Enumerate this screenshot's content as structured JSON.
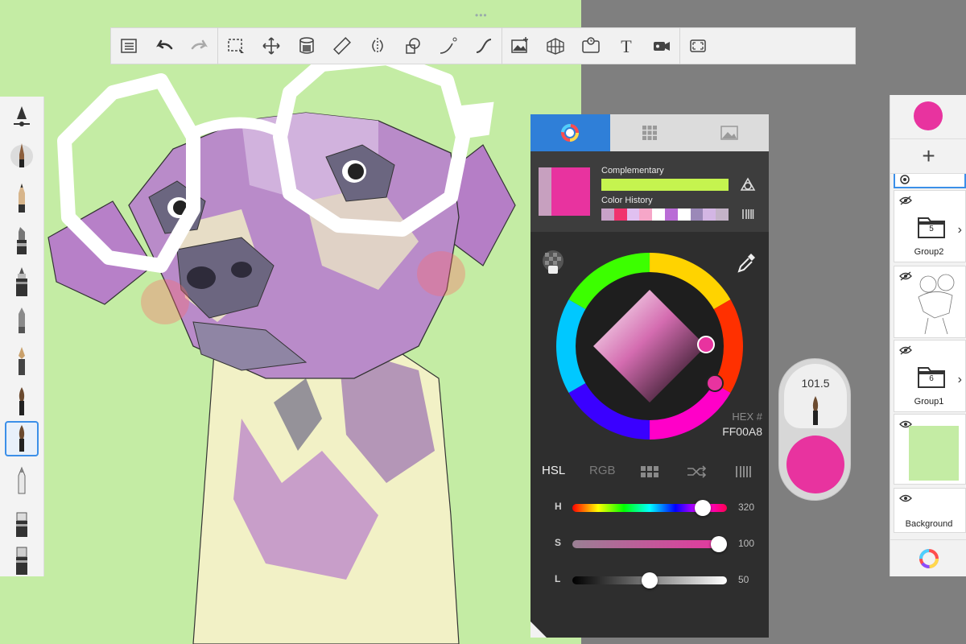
{
  "toolbar": {
    "items": [
      "layers-list",
      "undo",
      "redo",
      "selection",
      "transform",
      "fill",
      "ruler",
      "symmetry",
      "shapes",
      "stroke-path",
      "curve",
      "image-import",
      "perspective",
      "time-lapse",
      "text",
      "video",
      "fullscreen"
    ]
  },
  "color_editor": {
    "tabs": [
      "color-wheel",
      "swatch-grid",
      "image-picker"
    ],
    "complementary_label": "Complementary",
    "complementary_color": "#c5f44f",
    "color_history_label": "Color History",
    "color_history": [
      "#c8a2c8",
      "#f0336e",
      "#e0c0f0",
      "#f6a6c8",
      "#ffffff",
      "#b96cd6",
      "#ffffff",
      "#9b88b8",
      "#d3b6e4",
      "#c4b3c8"
    ],
    "current_color": "#e8339f",
    "previous_color": "#c7a0bf",
    "hex_label": "HEX #",
    "hex_value": "FF00A8",
    "modes": [
      "HSL",
      "RGB"
    ],
    "active_mode": "HSL",
    "sliders": [
      {
        "letter": "H",
        "value": "320"
      },
      {
        "letter": "S",
        "value": "100"
      },
      {
        "letter": "L",
        "value": "50"
      }
    ]
  },
  "puck": {
    "size": "101.5",
    "color": "#e8339f"
  },
  "layers": {
    "add_label": "+",
    "items": [
      {
        "name": "Group2",
        "count": "5"
      },
      {
        "name": "Group1",
        "count": "6"
      },
      {
        "name": "Background"
      }
    ],
    "active_color": "#e8339f"
  },
  "canvas": {
    "background_color": "#c4eca4",
    "handle": "•••"
  }
}
